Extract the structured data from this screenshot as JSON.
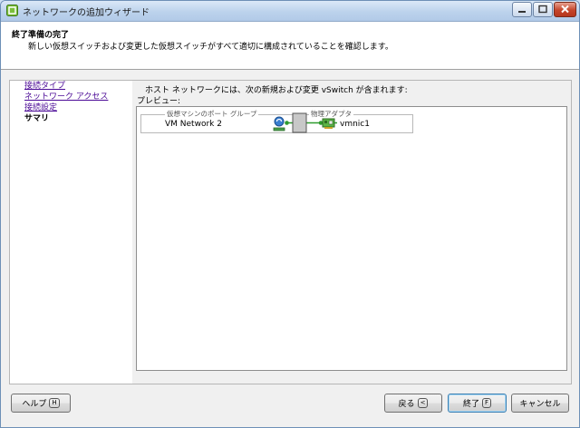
{
  "window": {
    "title": "ネットワークの追加ウィザード"
  },
  "header": {
    "title": "終了準備の完了",
    "description": "新しい仮想スイッチおよび変更した仮想スイッチがすべて適切に構成されていることを確認します。"
  },
  "nav": {
    "items": [
      {
        "label": "接続タイプ",
        "link": true
      },
      {
        "label": "ネットワーク アクセス",
        "link": true
      },
      {
        "label": "接続設定",
        "link": true
      },
      {
        "label": "サマリ",
        "link": false
      }
    ]
  },
  "content": {
    "intro": "ホスト ネットワークには、次の新規および変更 vSwitch が含まれます:",
    "preview_label": "プレビュー:",
    "vswitch": {
      "portgroup_header": "仮想マシンのポート グループ",
      "portgroup_name": "VM Network 2",
      "adapter_header": "物理アダプタ",
      "adapter_name": "vmnic1"
    }
  },
  "footer": {
    "help_label": "ヘルプ",
    "help_key": "H",
    "back_label": "戻る",
    "back_key": "<",
    "finish_label": "終了",
    "finish_key": "F",
    "cancel_label": "キャンセル"
  },
  "colors": {
    "link": "#4b0a96",
    "connector_green": "#2e9b2e",
    "titlebar": "#bcd2ec"
  }
}
